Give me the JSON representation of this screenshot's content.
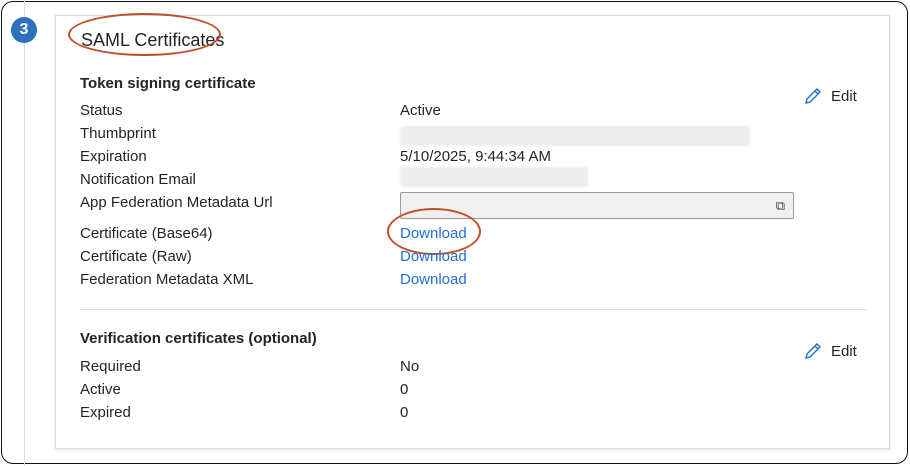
{
  "step_number": "3",
  "section_title": "SAML Certificates",
  "token_signing": {
    "heading": "Token signing certificate",
    "edit_label": "Edit",
    "rows": [
      {
        "label": "Status",
        "value": "Active"
      },
      {
        "label": "Thumbprint",
        "value": ""
      },
      {
        "label": "Expiration",
        "value": "5/10/2025, 9:44:34 AM"
      },
      {
        "label": "Notification Email",
        "value": ""
      },
      {
        "label": "App Federation Metadata Url",
        "value": ""
      },
      {
        "label": "Certificate (Base64)",
        "value": "Download"
      },
      {
        "label": "Certificate (Raw)",
        "value": "Download"
      },
      {
        "label": "Federation Metadata XML",
        "value": "Download"
      }
    ]
  },
  "verification": {
    "heading": "Verification certificates (optional)",
    "edit_label": "Edit",
    "rows": [
      {
        "label": "Required",
        "value": "No"
      },
      {
        "label": "Active",
        "value": "0"
      },
      {
        "label": "Expired",
        "value": "0"
      }
    ]
  },
  "colors": {
    "accent": "#1f6fd0",
    "annotation": "#c0502a",
    "step": "#2f6fbf"
  }
}
